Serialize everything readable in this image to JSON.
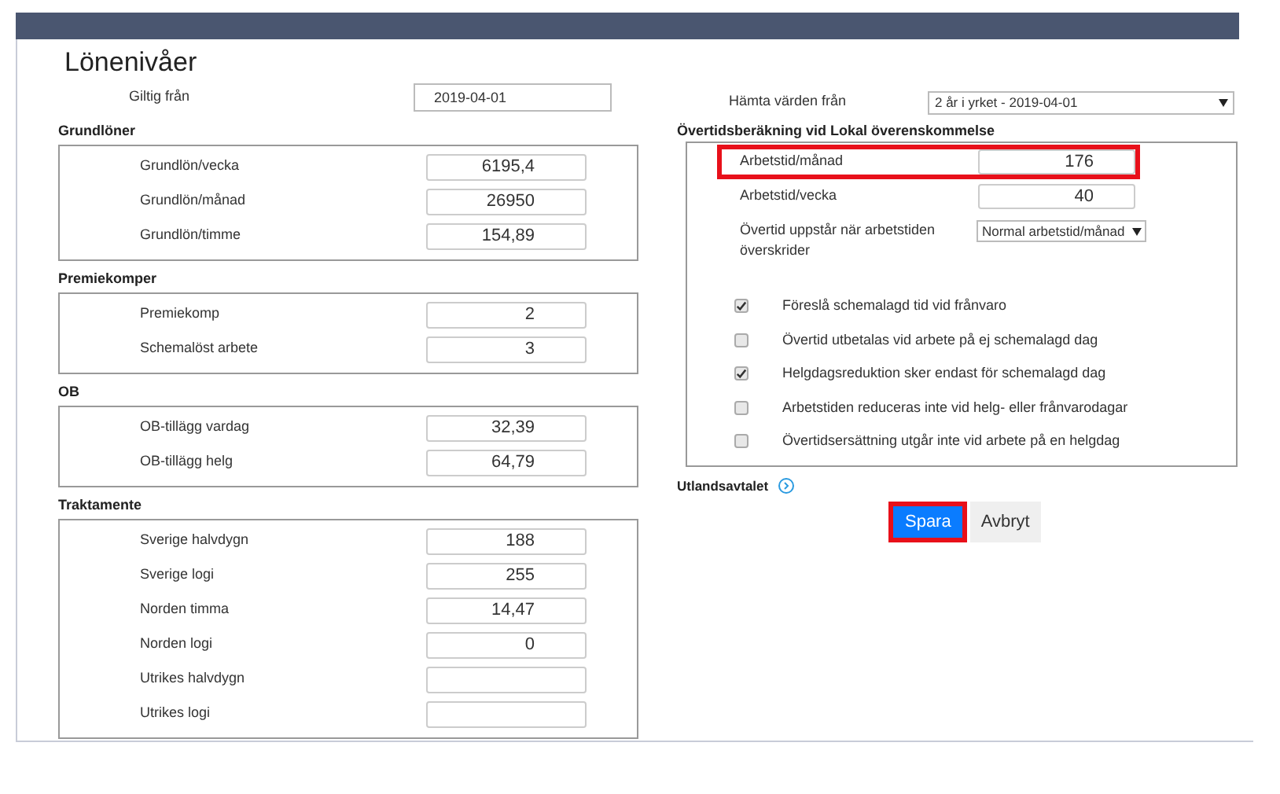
{
  "title": "Lönenivåer",
  "valid_from": {
    "label": "Giltig från",
    "value": "2019-04-01"
  },
  "sections": [
    {
      "heading": "Grundlöner",
      "fields": [
        {
          "label": "Grundlön/vecka",
          "value": "6195,4"
        },
        {
          "label": "Grundlön/månad",
          "value": "26950"
        },
        {
          "label": "Grundlön/timme",
          "value": "154,89"
        }
      ]
    },
    {
      "heading": "Premiekomper",
      "fields": [
        {
          "label": "Premiekomp",
          "value": "2"
        },
        {
          "label": "Schemalöst arbete",
          "value": "3"
        }
      ]
    },
    {
      "heading": "OB",
      "fields": [
        {
          "label": "OB-tillägg vardag",
          "value": "32,39"
        },
        {
          "label": "OB-tillägg helg",
          "value": "64,79"
        }
      ]
    },
    {
      "heading": "Traktamente",
      "fields": [
        {
          "label": "Sverige halvdygn",
          "value": "188"
        },
        {
          "label": "Sverige logi",
          "value": "255"
        },
        {
          "label": "Norden timma",
          "value": "14,47"
        },
        {
          "label": "Norden logi",
          "value": "0"
        },
        {
          "label": "Utrikes halvdygn"
        },
        {
          "label": "Utrikes logi"
        }
      ]
    }
  ],
  "fetch_from": {
    "label": "Hämta värden från",
    "value": "2 år i yrket - 2019-04-01"
  },
  "overtime": {
    "heading": "Övertidsberäkning vid Lokal överenskommelse",
    "fields": [
      {
        "label": "Arbetstid/månad",
        "value": "176",
        "highlighted": true
      },
      {
        "label": "Arbetstid/vecka",
        "value": "40",
        "highlighted": false
      }
    ],
    "select": {
      "label": "Övertid uppstår när arbetstiden överskrider",
      "value": "Normal arbetstid/månad"
    },
    "options": [
      {
        "label": "Föreslå schemalagd tid vid frånvaro",
        "checked": true
      },
      {
        "label": "Övertid utbetalas vid arbete på ej schemalagd dag",
        "checked": false
      },
      {
        "label": "Helgdagsreduktion sker endast för schemalagd dag",
        "checked": true
      },
      {
        "label": "Arbetstiden reduceras inte vid helg- eller frånvarodagar",
        "checked": false
      },
      {
        "label": "Övertidsersättning utgår inte vid arbete på en helgdag",
        "checked": false
      }
    ]
  },
  "foreign": {
    "label": "Utlandsavtalet"
  },
  "buttons": [
    {
      "label": "Spara",
      "kind": "primary",
      "highlighted": true
    },
    {
      "label": "Avbryt",
      "kind": "secondary",
      "highlighted": false
    }
  ]
}
